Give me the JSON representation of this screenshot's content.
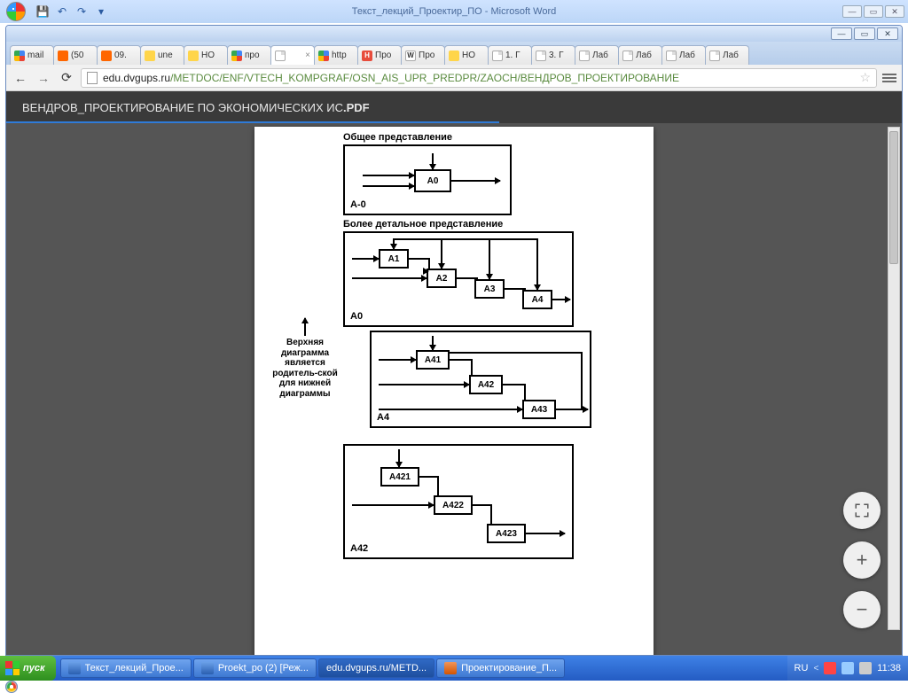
{
  "word": {
    "title": "Текст_лекций_Проектир_ПО - Microsoft Word"
  },
  "chrome": {
    "tabs": [
      {
        "fav": "g",
        "label": "mail"
      },
      {
        "fav": "o",
        "label": "(50"
      },
      {
        "fav": "o",
        "label": "09."
      },
      {
        "fav": "y",
        "label": "une"
      },
      {
        "fav": "y",
        "label": "НО"
      },
      {
        "fav": "g",
        "label": "про"
      },
      {
        "fav": "doc",
        "label": "",
        "active": true
      },
      {
        "fav": "g",
        "label": "http"
      },
      {
        "fav": "h",
        "label": "Про"
      },
      {
        "fav": "w",
        "label": "Про"
      },
      {
        "fav": "y",
        "label": "НО"
      },
      {
        "fav": "doc",
        "label": "1. Г"
      },
      {
        "fav": "doc",
        "label": "3. Г"
      },
      {
        "fav": "doc",
        "label": "Лаб"
      },
      {
        "fav": "doc",
        "label": "Лаб"
      },
      {
        "fav": "doc",
        "label": "Лаб"
      },
      {
        "fav": "doc",
        "label": "Лаб"
      }
    ],
    "url_host": "edu.dvgups.ru",
    "url_path": "/METDOC/ENF/VTECH_KOMPGRAF/OSN_AIS_UPR_PREDPR/ZAOCH/ВЕНДРОВ_ПРОЕКТИРОВАНИЕ",
    "pdf_title_a": "ВЕНДРОВ_ПРОЕКТИРОВАНИЕ ПО ЭКОНОМИЧЕСКИХ ИС",
    "pdf_title_b": ".PDF"
  },
  "doc": {
    "h1": "Общее представление",
    "h2": "Более детальное представление",
    "side": "Верхняя диаграмма является родитель-ской для нижней диаграммы",
    "f1": "A-0",
    "b_a0": "A0",
    "f2": "A0",
    "b_a1": "A1",
    "b_a2": "A2",
    "b_a3": "A3",
    "b_a4": "A4",
    "f3": "A4",
    "b_a41": "A41",
    "b_a42": "A42",
    "b_a43": "A43",
    "f4": "A42",
    "b_a421": "A421",
    "b_a422": "A422",
    "b_a423": "A423"
  },
  "taskbar": {
    "start": "пуск",
    "items": [
      {
        "ic": "word",
        "label": "Текст_лекций_Прое...",
        "active": false
      },
      {
        "ic": "word",
        "label": "Proekt_po (2) [Реж...",
        "active": false
      },
      {
        "ic": "chrome",
        "label": "edu.dvgups.ru/METD...",
        "active": true
      },
      {
        "ic": "ppt",
        "label": "Проектирование_П...",
        "active": false
      }
    ],
    "lang": "RU",
    "clock": "11:38"
  }
}
